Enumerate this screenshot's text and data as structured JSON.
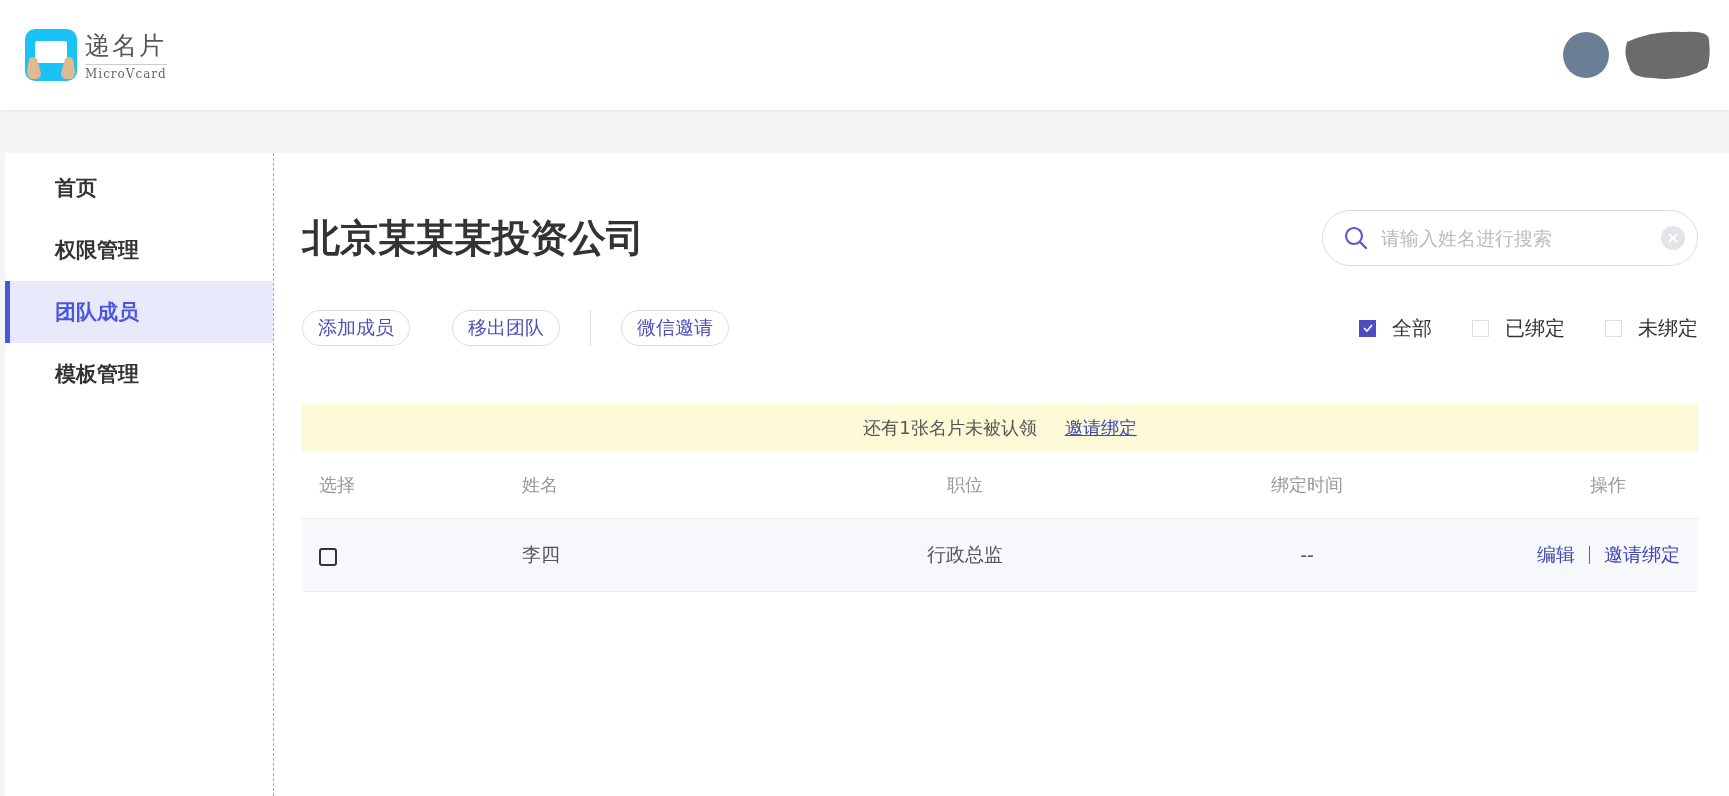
{
  "header": {
    "logo_title": "递名片",
    "logo_subtitle": "MicroVcard"
  },
  "sidebar": {
    "items": [
      {
        "label": "首页",
        "selected": false
      },
      {
        "label": "权限管理",
        "selected": false
      },
      {
        "label": "团队成员",
        "selected": true
      },
      {
        "label": "模板管理",
        "selected": false
      }
    ]
  },
  "main": {
    "title": "北京某某某投资公司",
    "search": {
      "placeholder": "请输入姓名进行搜索"
    },
    "action_groups": [
      [
        "添加成员",
        "移出团队"
      ],
      [
        "微信邀请"
      ]
    ],
    "filters": [
      {
        "label": "全部",
        "checked": true
      },
      {
        "label": "已绑定",
        "checked": false
      },
      {
        "label": "未绑定",
        "checked": false
      }
    ],
    "notice": {
      "text": "还有1张名片未被认领",
      "link": "邀请绑定"
    },
    "table": {
      "columns": [
        "选择",
        "姓名",
        "职位",
        "绑定时间",
        "操作"
      ],
      "rows": [
        {
          "checked": false,
          "name": "李四",
          "position": "行政总监",
          "bind_time": "--",
          "actions": [
            "编辑",
            "邀请绑定"
          ]
        }
      ]
    }
  }
}
